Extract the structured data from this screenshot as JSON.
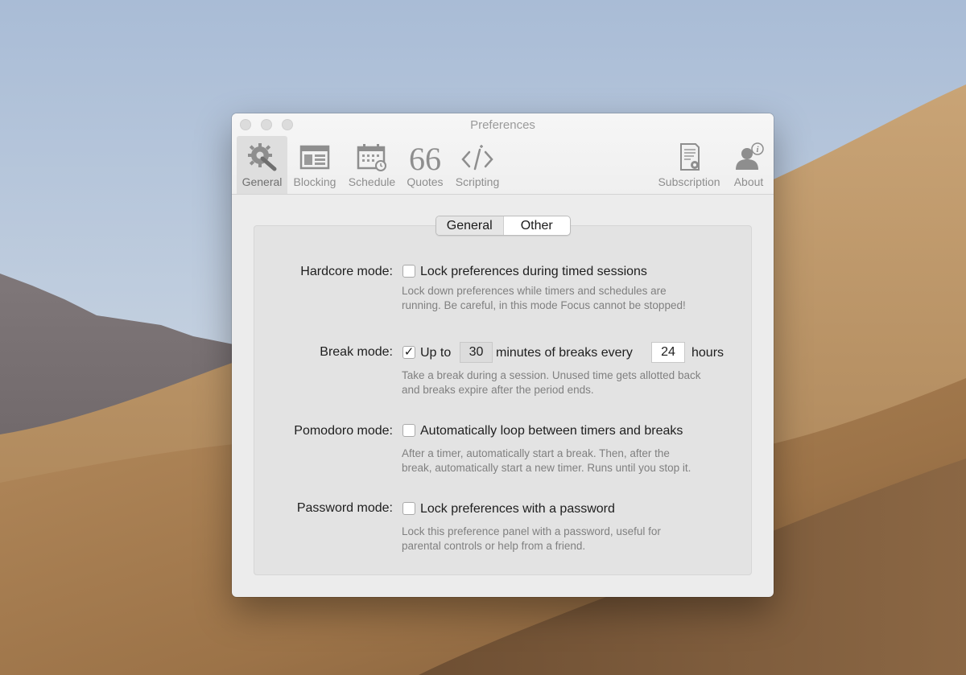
{
  "window": {
    "title": "Preferences"
  },
  "toolbar": {
    "items": [
      {
        "label": "General",
        "icon": "gear-wrench-icon",
        "selected": true
      },
      {
        "label": "Blocking",
        "icon": "browser-window-icon",
        "selected": false
      },
      {
        "label": "Schedule",
        "icon": "calendar-clock-icon",
        "selected": false
      },
      {
        "label": "Quotes",
        "icon": "quote-icon",
        "selected": false
      },
      {
        "label": "Scripting",
        "icon": "code-icon",
        "selected": false
      },
      {
        "label": "Subscription",
        "icon": "certificate-icon",
        "selected": false
      },
      {
        "label": "About",
        "icon": "user-info-icon",
        "selected": false
      }
    ]
  },
  "tabs": {
    "general": "General",
    "other": "Other",
    "selected": "General"
  },
  "settings": {
    "hardcore": {
      "label": "Hardcore mode:",
      "checked": false,
      "text": "Lock preferences during timed sessions",
      "desc_line1": "Lock down preferences while timers and schedules are",
      "desc_line2": "running. Be careful, in this mode Focus cannot be stopped!"
    },
    "break": {
      "label": "Break mode:",
      "checked": true,
      "text_before": "Up to",
      "minutes": "30",
      "text_middle": "minutes of breaks every",
      "hours": "24",
      "text_after": "hours",
      "desc_line1": "Take a break during a session. Unused time gets allotted back",
      "desc_line2": "and breaks expire after the period ends."
    },
    "pomodoro": {
      "label": "Pomodoro mode:",
      "checked": false,
      "text": "Automatically loop between timers and breaks",
      "desc_line1": "After a timer, automatically start a break. Then, after the",
      "desc_line2": "break, automatically start a new timer. Runs until you stop it."
    },
    "password": {
      "label": "Password mode:",
      "checked": false,
      "text": "Lock preferences with a password",
      "desc_line1": "Lock this preference panel with a password, useful for",
      "desc_line2": "parental controls or help from a friend."
    }
  },
  "colors": {
    "window_bg": "#ececec",
    "panel_bg": "#e3e3e3",
    "icon_gray": "#8e8e8e"
  }
}
